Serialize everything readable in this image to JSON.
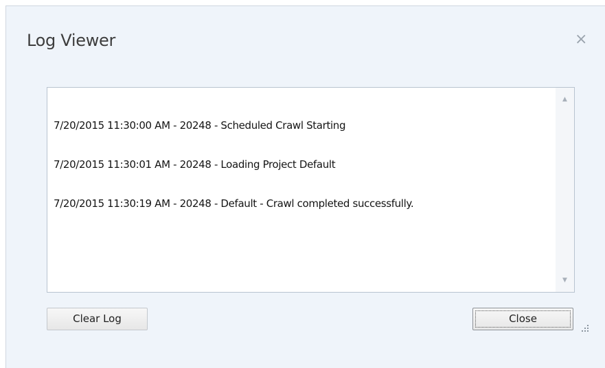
{
  "window": {
    "title": "Log Viewer",
    "close_glyph": "×"
  },
  "log": {
    "lines": [
      "7/20/2015 11:30:00 AM - 20248 - Scheduled Crawl Starting",
      "7/20/2015 11:30:01 AM - 20248 - Loading Project Default",
      "7/20/2015 11:30:19 AM - 20248 - Default - Crawl completed successfully."
    ],
    "scroll_up_glyph": "▲",
    "scroll_down_glyph": "▼"
  },
  "buttons": {
    "clear_label": "Clear Log",
    "close_label": "Close"
  },
  "colors": {
    "dialog_background": "#eff4fa",
    "text": "#141414"
  },
  "icons": {
    "close": "close-icon",
    "scroll_up": "scroll-up-arrow-icon",
    "scroll_down": "scroll-down-arrow-icon",
    "resize": "resize-grip-icon"
  }
}
